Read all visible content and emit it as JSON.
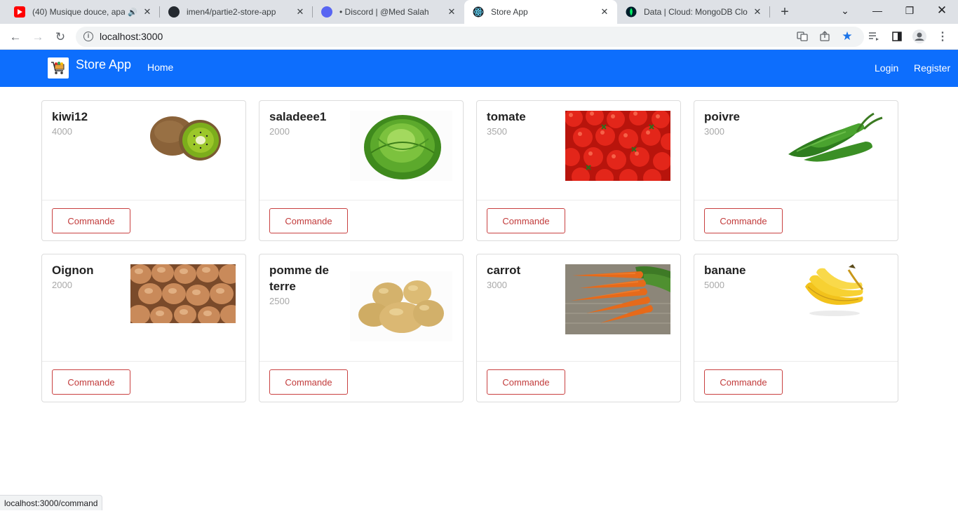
{
  "browser": {
    "tabs": [
      {
        "title": "(40) Musique douce, apa",
        "active": false
      },
      {
        "title": "imen4/partie2-store-app",
        "active": false
      },
      {
        "title": "• Discord | @Med Salah",
        "active": false
      },
      {
        "title": "Store App",
        "active": true
      },
      {
        "title": "Data | Cloud: MongoDB Clou",
        "active": false
      }
    ],
    "url": "localhost:3000",
    "status_url": "localhost:3000/command"
  },
  "navbar": {
    "brand": "Store App",
    "home": "Home",
    "login": "Login",
    "register": "Register"
  },
  "products": [
    {
      "name": "kiwi12",
      "price": "4000",
      "action": "Commande",
      "image": "kiwi"
    },
    {
      "name": "saladeee1",
      "price": "2000",
      "action": "Commande",
      "image": "lettuce"
    },
    {
      "name": "tomate",
      "price": "3500",
      "action": "Commande",
      "image": "tomatoes"
    },
    {
      "name": "poivre",
      "price": "3000",
      "action": "Commande",
      "image": "green-peppers"
    },
    {
      "name": "Oignon",
      "price": "2000",
      "action": "Commande",
      "image": "onions"
    },
    {
      "name": "pomme de terre",
      "price": "2500",
      "action": "Commande",
      "image": "potatoes"
    },
    {
      "name": "carrot",
      "price": "3000",
      "action": "Commande",
      "image": "carrots"
    },
    {
      "name": "banane",
      "price": "5000",
      "action": "Commande",
      "image": "bananas"
    }
  ],
  "colors": {
    "navbar": "#0d6efd",
    "button_border": "#c94040"
  }
}
